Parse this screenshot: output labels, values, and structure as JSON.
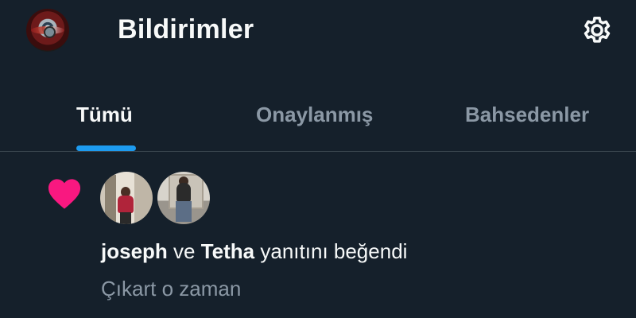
{
  "header": {
    "title": "Bildirimler",
    "avatar_icon": "profile-avatar",
    "settings_icon": "gear-icon"
  },
  "tabs": [
    {
      "label": "Tümü",
      "active": true
    },
    {
      "label": "Onaylanmış",
      "active": false
    },
    {
      "label": "Bahsedenler",
      "active": false
    }
  ],
  "notification": {
    "icon": "heart-icon",
    "icon_color": "#f91880",
    "users": [
      {
        "name": "joseph"
      },
      {
        "name": "Tetha"
      }
    ],
    "connector": "ve",
    "action": "yanıtını beğendi",
    "quoted_text": "Çıkart o zaman"
  },
  "colors": {
    "background": "#15202b",
    "accent": "#1d9bf0",
    "text_primary": "#f7f9f9",
    "text_secondary": "#8b98a5",
    "divider": "#38444d"
  }
}
